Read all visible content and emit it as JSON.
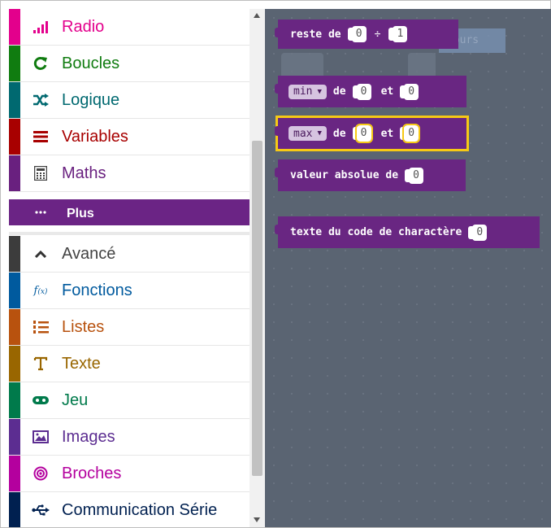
{
  "toolbox": {
    "categories": [
      {
        "label": "Radio",
        "icon": "signal-bars-icon",
        "color": "#e3008c"
      },
      {
        "label": "Boucles",
        "icon": "refresh-icon",
        "color": "#107c10"
      },
      {
        "label": "Logique",
        "icon": "shuffle-icon",
        "color": "#006970"
      },
      {
        "label": "Variables",
        "icon": "list-lines-icon",
        "color": "#a80000"
      },
      {
        "label": "Maths",
        "icon": "calculator-icon",
        "color": "#69207f"
      },
      {
        "label": "Plus",
        "icon": "ellipsis-icon",
        "color": "#692682"
      },
      {
        "label": "Avancé",
        "icon": "chevron-up-icon",
        "color": "#3c3c3c"
      },
      {
        "label": "Fonctions",
        "icon": "function-icon",
        "color": "#005a9e"
      },
      {
        "label": "Listes",
        "icon": "numbered-list-icon",
        "color": "#b8520e"
      },
      {
        "label": "Texte",
        "icon": "text-icon",
        "color": "#996600"
      },
      {
        "label": "Jeu",
        "icon": "gamepad-icon",
        "color": "#007a4b"
      },
      {
        "label": "Images",
        "icon": "image-icon",
        "color": "#5c2d91"
      },
      {
        "label": "Broches",
        "icon": "target-icon",
        "color": "#b4009e"
      },
      {
        "label": "Communication Série",
        "icon": "usb-icon",
        "color": "#002050"
      }
    ]
  },
  "workspace": {
    "background_text": "jours",
    "blocks": {
      "remainder": {
        "label": "reste de",
        "a": "0",
        "op": "÷",
        "b": "1"
      },
      "min": {
        "fn": "min",
        "de": "de",
        "a": "0",
        "et": "et",
        "b": "0"
      },
      "max": {
        "fn": "max",
        "de": "de",
        "a": "0",
        "et": "et",
        "b": "0"
      },
      "abs": {
        "label": "valeur absolue de",
        "a": "0"
      },
      "char": {
        "label": "texte du code de charactère",
        "a": "0"
      }
    }
  },
  "colors": {
    "maths": "#692682",
    "selection": "#f6c915",
    "workspace": "#5a6472"
  }
}
